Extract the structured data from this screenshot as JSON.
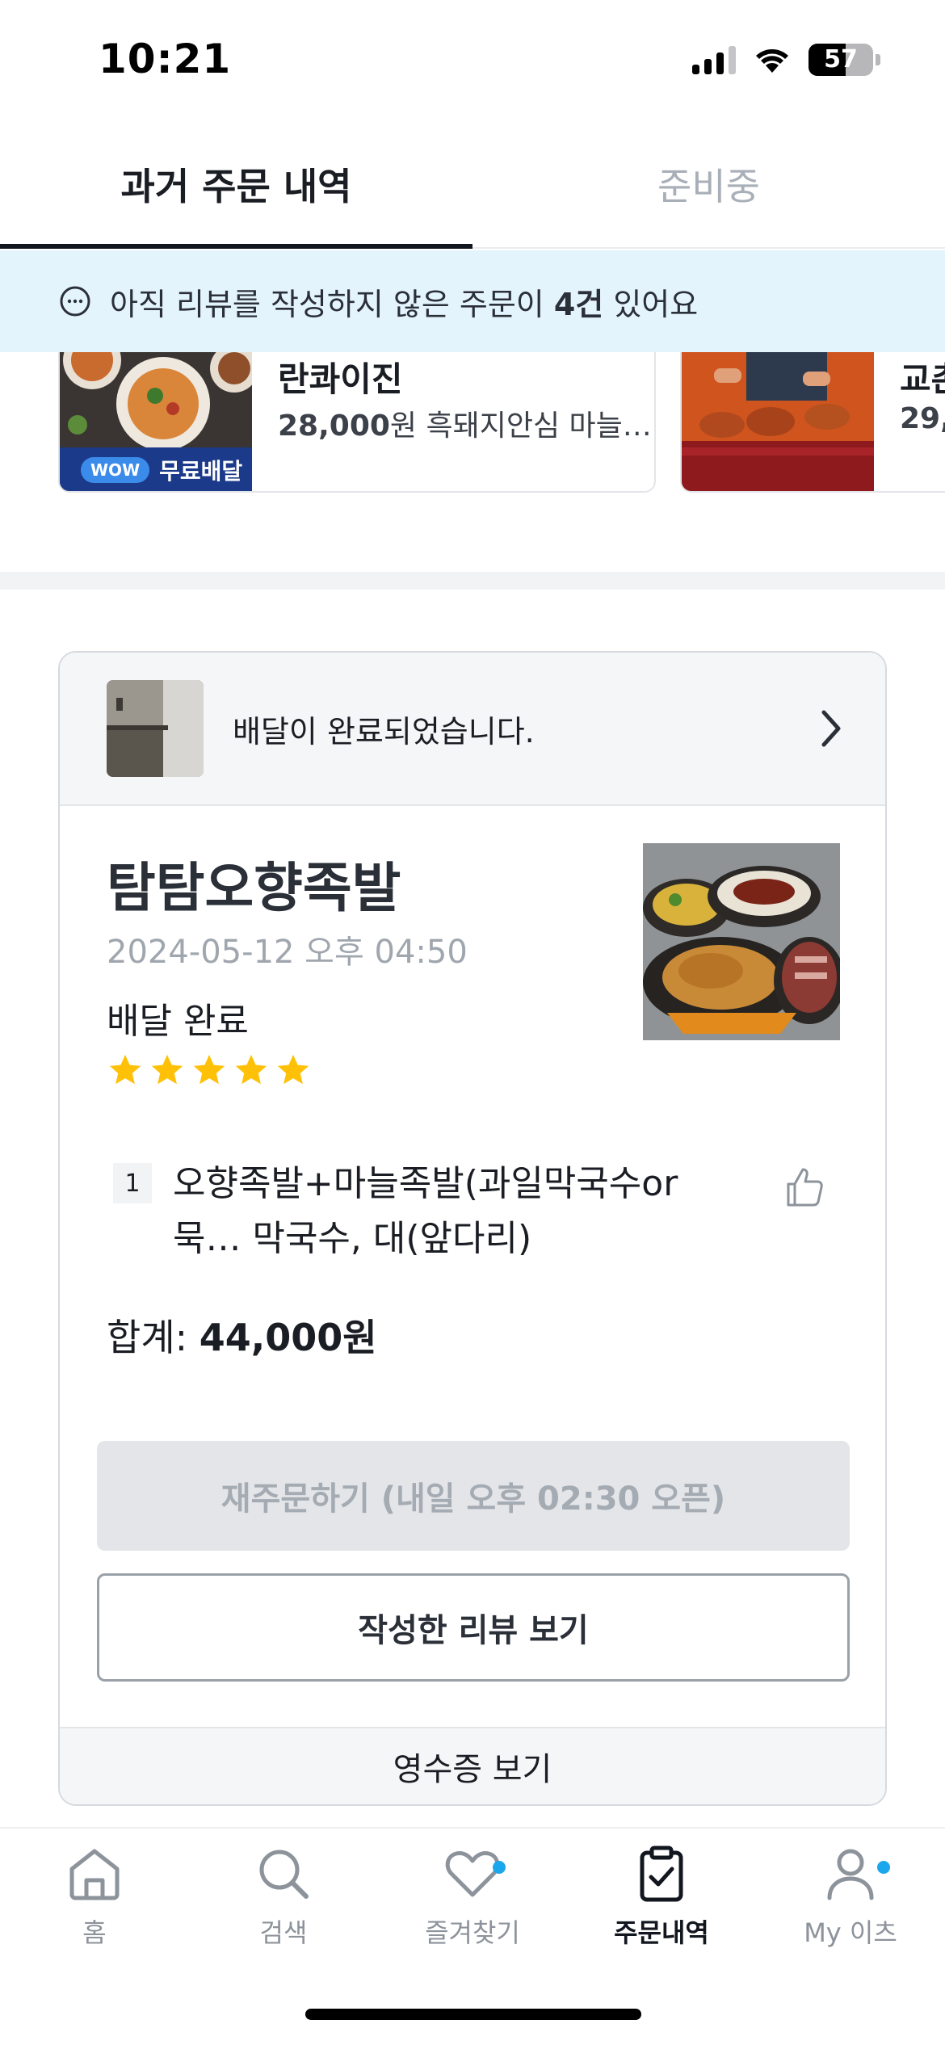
{
  "status_bar": {
    "time": "10:21",
    "battery": "57"
  },
  "tabs": [
    {
      "label": "과거 주문 내역",
      "active": true
    },
    {
      "label": "준비중",
      "active": false
    }
  ],
  "review_banner": {
    "prefix": "아직 리뷰를 작성하지 않은 주문이 ",
    "count": "4건",
    "suffix": " 있어요"
  },
  "carousel": {
    "cards": [
      {
        "name": "란콰이진",
        "price": "28,000",
        "price_unit": "원",
        "menu": " 흑돼지안심 마늘…",
        "badge_pill": "WOW",
        "badge_text": "무료배달"
      },
      {
        "name": "교촌",
        "price": "29,",
        "price_unit": "",
        "menu": ""
      }
    ]
  },
  "order": {
    "delivery_status_message": "배달이 완료되었습니다.",
    "store_name": "탐탐오향족발",
    "date": "2024-05-12 오후 04:50",
    "status": "배달 완료",
    "rating": 5,
    "items": [
      {
        "qty": "1",
        "name": "오향족발+마늘족발(과일막국수or 묵… 막국수, 대(앞다리)"
      }
    ],
    "total_label": "합계: ",
    "total_value": "44,000원",
    "reorder_button": "재주문하기 (내일 오후 02:30 오픈)",
    "review_button": "작성한 리뷰 보기",
    "receipt_button": "영수증 보기"
  },
  "bottom_nav": [
    {
      "label": "홈",
      "icon": "home-icon",
      "active": false
    },
    {
      "label": "검색",
      "icon": "search-icon",
      "active": false
    },
    {
      "label": "즐겨찾기",
      "icon": "heart-icon",
      "active": false,
      "dot": true
    },
    {
      "label": "주문내역",
      "icon": "clipboard-check-icon",
      "active": true
    },
    {
      "label": "My 이츠",
      "icon": "person-icon",
      "active": false,
      "dot": true
    }
  ],
  "colors": {
    "accent_dot": "#1aa7ec",
    "banner_bg": "#e4f4fd",
    "star": "#ffc107",
    "wow_badge": "#1b3a8a"
  }
}
